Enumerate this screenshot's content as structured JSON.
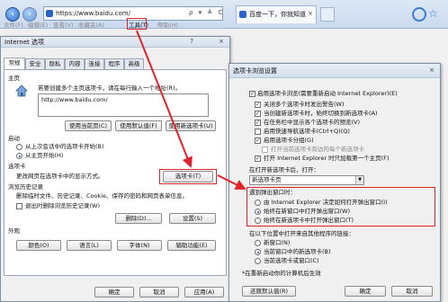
{
  "browser": {
    "back_icon": "back-arrow-icon",
    "forward_icon": "forward-arrow-icon",
    "address": "https://www.baidu.com/",
    "address_icons": "ρ ▾ ≜ C",
    "tab_title": "百度一下，你就知道",
    "tab_close": "×",
    "menu": [
      "文件(F)",
      "编辑(E)",
      "查看(V)",
      "收藏夹(A)",
      "工具(T)",
      "帮助(H)"
    ],
    "highlight_color": "#e2222b"
  },
  "inet_options": {
    "title": "Internet 选项",
    "help": "?",
    "close": "×",
    "tabs": [
      "常规",
      "安全",
      "隐私",
      "内容",
      "连接",
      "程序",
      "高级"
    ],
    "homepage": {
      "heading": "主页",
      "description": "若要创建多个主页选项卡，请在每行输入一个地址(R)。",
      "url": "http://www.baidu.com/",
      "btn_current": "使用当前页(C)",
      "btn_default": "使用默认值(F)",
      "btn_new_tab": "使用新选项卡(U)"
    },
    "startup": {
      "heading": "启动",
      "opt_last": "从上次会话中的选项卡开始(B)",
      "opt_home": "从主页开始(H)"
    },
    "tabs_section": {
      "heading": "选项卡",
      "description": "更改网页在选项卡中的显示方式。",
      "btn": "选项卡(T)"
    },
    "history": {
      "heading": "浏览历史记录",
      "description": "删除临时文件、历史记录、Cookie、保存的密码和网页表单信息。",
      "checkbox": "退出时删除浏览历史记录(W)",
      "btn_delete": "删除(D)...",
      "btn_settings": "设置(S)"
    },
    "appearance": {
      "heading": "外观",
      "btn_colors": "颜色(O)",
      "btn_languages": "语言(L)",
      "btn_fonts": "字体(N)",
      "btn_accessibility": "辅助功能(E)"
    },
    "footer": {
      "ok": "确定",
      "cancel": "取消",
      "apply": "应用(A)"
    }
  },
  "tab_settings": {
    "title": "选项卡浏览设置",
    "close": "×",
    "enable": "启用选项卡浏览(需要重新启动 Internet Explorer)(E)",
    "checks": [
      {
        "label": "关闭多个选项卡时发出警告(W)",
        "checked": true
      },
      {
        "label": "当创建新选项卡时，始终切换到新选项卡(A)",
        "checked": true
      },
      {
        "label": "在任务栏中显示各个选项卡的预览(V)",
        "checked": true
      },
      {
        "label": "启用快速导航选项卡(Ctrl+Q)(Q)",
        "checked": false
      },
      {
        "label": "启用选项卡分组(G)",
        "checked": true
      },
      {
        "label": "打开当前选项卡旁边的每个新选项卡",
        "checked": false,
        "indent": true,
        "disabled": true
      },
      {
        "label": "打开 Internet Explorer 时只加载第一个主页(F)",
        "checked": true
      }
    ],
    "new_tab_label": "在打开新选项卡后，打开：",
    "new_tab_value": "新选项卡页",
    "popup_group": "遇到弹出窗口时：",
    "popup_opts": [
      {
        "label": "由 Internet Explorer 决定如何打开弹出窗口(I)",
        "on": false
      },
      {
        "label": "始终在新窗口中打开弹出窗口(W)",
        "on": true
      },
      {
        "label": "始终在新选项卡中打开弹出窗口(T)",
        "on": false
      }
    ],
    "links_group": "在以下位置中打开来自其他程序的链接：",
    "links_opts": [
      {
        "label": "新窗口(N)",
        "on": false
      },
      {
        "label": "当前窗口中的新选项卡(B)",
        "on": true
      },
      {
        "label": "当前选项卡或窗口(C)",
        "on": false
      }
    ],
    "note": "*在重新启动你的计算机后生效",
    "footer": {
      "restore": "还原默认值(R)",
      "ok": "确定",
      "cancel": "取消"
    }
  }
}
